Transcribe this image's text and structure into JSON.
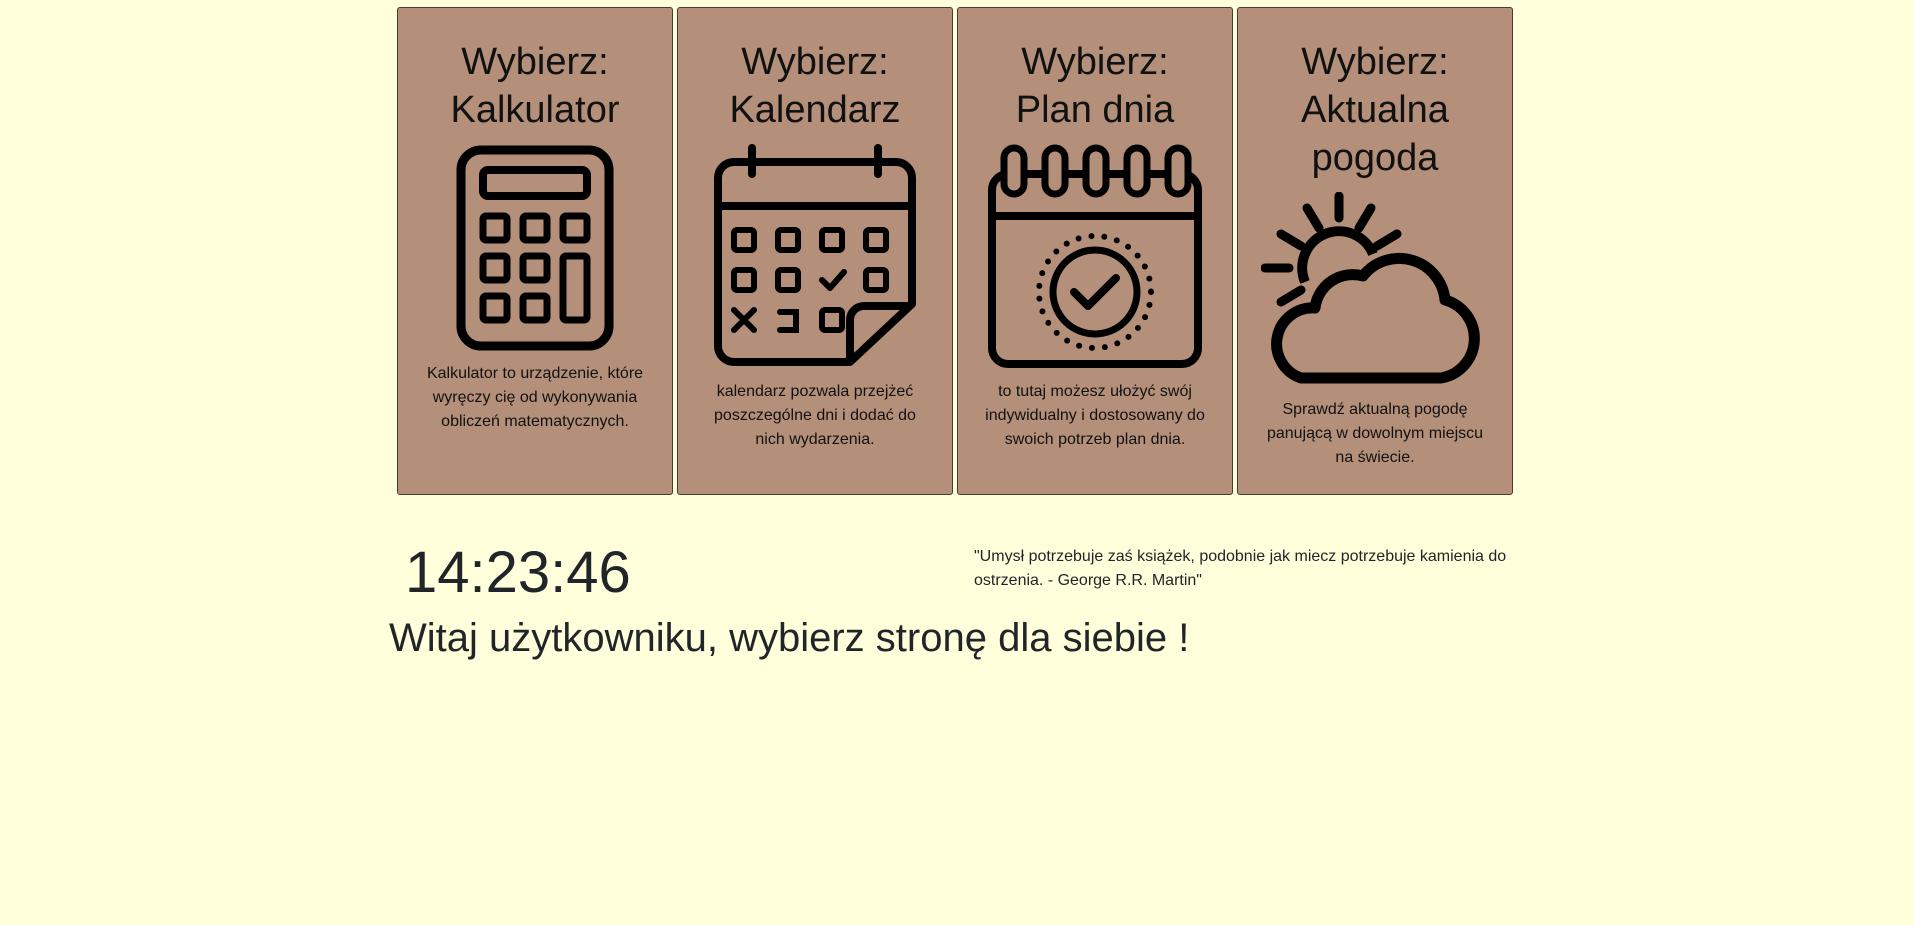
{
  "cards": [
    {
      "title_line1": "Wybierz:",
      "title_line2": "Kalkulator",
      "title_line3": "",
      "icon": "calculator-icon",
      "description": "Kalkulator to urządzenie, które wyręczy cię od wykonywania obliczeń matematycznych."
    },
    {
      "title_line1": "Wybierz:",
      "title_line2": "Kalendarz",
      "title_line3": "",
      "icon": "calendar-icon",
      "description": "kalendarz pozwala przejżeć poszczególne dni i dodać do nich wydarzenia."
    },
    {
      "title_line1": "Wybierz:",
      "title_line2": "Plan dnia",
      "title_line3": "",
      "icon": "day-plan-icon",
      "description": "to tutaj możesz ułożyć swój indywidualny i dostosowany do swoich potrzeb plan dnia."
    },
    {
      "title_line1": "Wybierz:",
      "title_line2": "Aktualna",
      "title_line3": "pogoda",
      "icon": "weather-icon",
      "description": "Sprawdź aktualną pogodę panującą w dowolnym miejscu na świecie."
    }
  ],
  "clock": {
    "time": "14:23:46"
  },
  "quote": {
    "text": "\"Umysł potrzebuje zaś książek, podobnie jak miecz potrzebuje kamienia do ostrzenia. - George R.R. Martin\""
  },
  "welcome": {
    "text": "Witaj użytkowniku, wybierz stronę dla siebie !"
  },
  "colors": {
    "background": "#ffffdb",
    "card_background": "#b48f7a",
    "card_border": "#4b3a30",
    "text": "#212529"
  }
}
